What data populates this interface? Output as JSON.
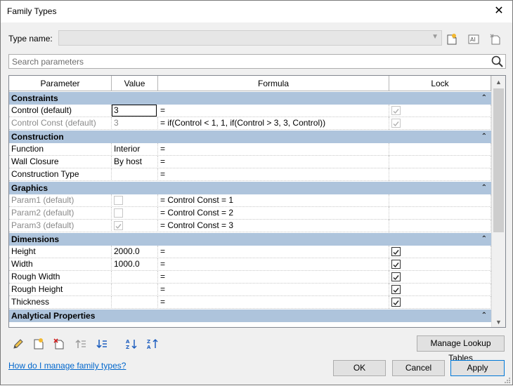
{
  "window": {
    "title": "Family Types"
  },
  "type_name": {
    "label": "Type name:",
    "value": ""
  },
  "search": {
    "placeholder": "Search parameters"
  },
  "columns": [
    "Parameter",
    "Value",
    "Formula",
    "Lock"
  ],
  "groups": {
    "constraints": {
      "title": "Constraints",
      "rows": [
        {
          "param": "Control (default)",
          "value": "3",
          "formula": "="
        },
        {
          "param": "Control Const (default)",
          "value": "3",
          "formula": "= if(Control < 1, 1, if(Control > 3, 3, Control))"
        }
      ]
    },
    "construction": {
      "title": "Construction",
      "rows": [
        {
          "param": "Function",
          "value": "Interior",
          "formula": "="
        },
        {
          "param": "Wall Closure",
          "value": "By host",
          "formula": "="
        },
        {
          "param": "Construction Type",
          "value": "",
          "formula": "="
        }
      ]
    },
    "graphics": {
      "title": "Graphics",
      "rows": [
        {
          "param": "Param1 (default)",
          "formula": "= Control Const = 1"
        },
        {
          "param": "Param2 (default)",
          "formula": "= Control Const = 2"
        },
        {
          "param": "Param3 (default)",
          "formula": "= Control Const = 3"
        }
      ]
    },
    "dimensions": {
      "title": "Dimensions",
      "rows": [
        {
          "param": "Height",
          "value": "2000.0",
          "formula": "="
        },
        {
          "param": "Width",
          "value": "1000.0",
          "formula": "="
        },
        {
          "param": "Rough Width",
          "value": "",
          "formula": "="
        },
        {
          "param": "Rough Height",
          "value": "",
          "formula": "="
        },
        {
          "param": "Thickness",
          "value": "",
          "formula": "="
        }
      ]
    },
    "analytical": {
      "title": "Analytical Properties"
    }
  },
  "buttons": {
    "manage_lookup": "Manage Lookup Tables",
    "ok": "OK",
    "cancel": "Cancel",
    "apply": "Apply"
  },
  "help_link": "How do I manage family types?",
  "icons": [
    "close-icon",
    "new-type-icon",
    "rename-type-icon",
    "delete-type-icon",
    "search-icon",
    "edit-parameter-icon",
    "new-parameter-icon",
    "delete-parameter-icon",
    "move-up-icon",
    "move-down-icon",
    "sort-ascending-icon",
    "sort-descending-icon"
  ]
}
